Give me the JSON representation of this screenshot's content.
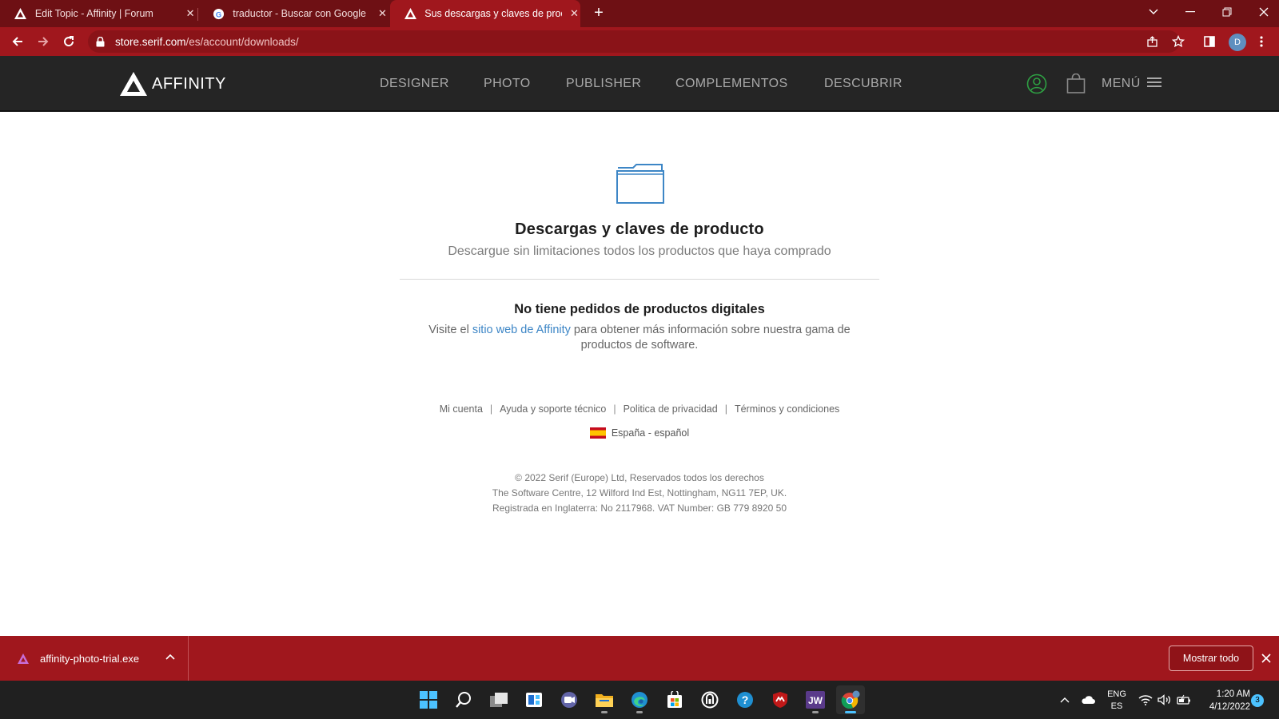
{
  "browser": {
    "tabs": [
      {
        "title": "Edit Topic - Affinity | Forum"
      },
      {
        "title": "traductor - Buscar con Google"
      },
      {
        "title": "Sus descargas y claves de producto"
      }
    ],
    "url_host": "store.serif.com",
    "url_path": "/es/account/downloads/",
    "profile_initial": "D"
  },
  "site": {
    "logo_text": "AFFINITY",
    "nav": [
      "DESIGNER",
      "PHOTO",
      "PUBLISHER",
      "COMPLEMENTOS",
      "DESCUBRIR"
    ],
    "menu_label": "MENÚ"
  },
  "main": {
    "title": "Descargas y claves de producto",
    "subtitle": "Descargue sin limitaciones todos los productos que haya comprado",
    "empty_title": "No tiene pedidos de productos digitales",
    "empty_text_before": "Visite el ",
    "empty_link": "sitio web de Affinity",
    "empty_text_after": " para obtener más información sobre nuestra gama de productos de software."
  },
  "footer": {
    "links": [
      "Mi cuenta",
      "Ayuda y soporte técnico",
      "Politica de privacidad",
      "Términos y condiciones"
    ],
    "separator": "|",
    "locale": "España - español",
    "legal": [
      "© 2022 Serif (Europe) Ltd, Reservados todos los derechos",
      "The Software Centre, 12 Wilford Ind Est, Nottingham, NG11 7EP, UK.",
      "Registrada en Inglaterra: No 2117968. VAT Number: GB 779 8920 50"
    ]
  },
  "downloads": {
    "file": "affinity-photo-trial.exe",
    "show_all": "Mostrar todo"
  },
  "taskbar": {
    "lang_1": "ENG",
    "lang_2": "ES",
    "time": "1:20 AM",
    "date": "4/12/2022",
    "notifications": "3"
  },
  "colors": {
    "browser_accent": "#a0171d",
    "tabstrip": "#6e1014",
    "site_header": "#252525",
    "link": "#3d86c6",
    "folder_icon": "#3d86c6",
    "account_icon": "#2ea043"
  }
}
